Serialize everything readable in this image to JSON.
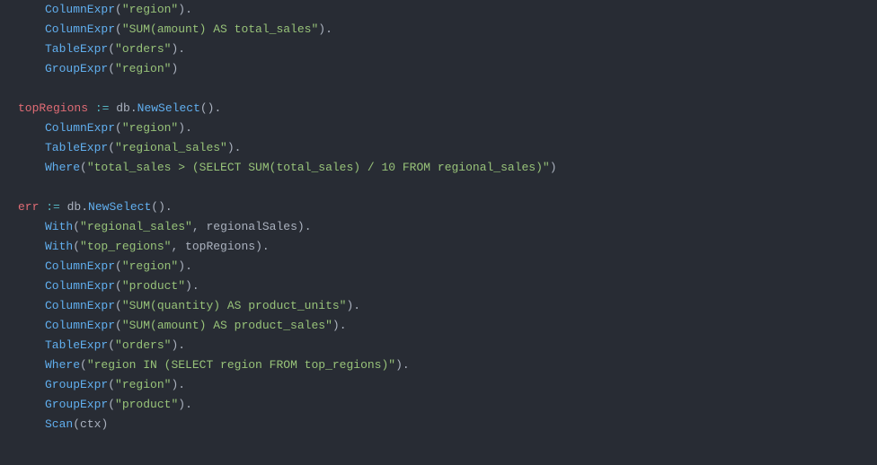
{
  "lines": [
    {
      "indent": 1,
      "tokens": [
        {
          "t": "method",
          "v": "ColumnExpr"
        },
        {
          "t": "paren",
          "v": "("
        },
        {
          "t": "string",
          "v": "\"region\""
        },
        {
          "t": "paren",
          "v": ")"
        },
        {
          "t": "dot",
          "v": "."
        }
      ]
    },
    {
      "indent": 1,
      "tokens": [
        {
          "t": "method",
          "v": "ColumnExpr"
        },
        {
          "t": "paren",
          "v": "("
        },
        {
          "t": "string",
          "v": "\"SUM(amount) AS total_sales\""
        },
        {
          "t": "paren",
          "v": ")"
        },
        {
          "t": "dot",
          "v": "."
        }
      ]
    },
    {
      "indent": 1,
      "tokens": [
        {
          "t": "method",
          "v": "TableExpr"
        },
        {
          "t": "paren",
          "v": "("
        },
        {
          "t": "string",
          "v": "\"orders\""
        },
        {
          "t": "paren",
          "v": ")"
        },
        {
          "t": "dot",
          "v": "."
        }
      ]
    },
    {
      "indent": 1,
      "tokens": [
        {
          "t": "method",
          "v": "GroupExpr"
        },
        {
          "t": "paren",
          "v": "("
        },
        {
          "t": "string",
          "v": "\"region\""
        },
        {
          "t": "paren",
          "v": ")"
        }
      ]
    },
    {
      "indent": 0,
      "tokens": []
    },
    {
      "indent": 0,
      "tokens": [
        {
          "t": "ident",
          "v": "topRegions"
        },
        {
          "t": "var",
          "v": " "
        },
        {
          "t": "op",
          "v": ":="
        },
        {
          "t": "var",
          "v": " db"
        },
        {
          "t": "dot",
          "v": "."
        },
        {
          "t": "method",
          "v": "NewSelect"
        },
        {
          "t": "paren",
          "v": "()"
        },
        {
          "t": "dot",
          "v": "."
        }
      ]
    },
    {
      "indent": 1,
      "tokens": [
        {
          "t": "method",
          "v": "ColumnExpr"
        },
        {
          "t": "paren",
          "v": "("
        },
        {
          "t": "string",
          "v": "\"region\""
        },
        {
          "t": "paren",
          "v": ")"
        },
        {
          "t": "dot",
          "v": "."
        }
      ]
    },
    {
      "indent": 1,
      "tokens": [
        {
          "t": "method",
          "v": "TableExpr"
        },
        {
          "t": "paren",
          "v": "("
        },
        {
          "t": "string",
          "v": "\"regional_sales\""
        },
        {
          "t": "paren",
          "v": ")"
        },
        {
          "t": "dot",
          "v": "."
        }
      ]
    },
    {
      "indent": 1,
      "tokens": [
        {
          "t": "method",
          "v": "Where"
        },
        {
          "t": "paren",
          "v": "("
        },
        {
          "t": "string",
          "v": "\"total_sales > (SELECT SUM(total_sales) / 10 FROM regional_sales)\""
        },
        {
          "t": "paren",
          "v": ")"
        }
      ]
    },
    {
      "indent": 0,
      "tokens": []
    },
    {
      "indent": 0,
      "tokens": [
        {
          "t": "ident",
          "v": "err"
        },
        {
          "t": "var",
          "v": " "
        },
        {
          "t": "op",
          "v": ":="
        },
        {
          "t": "var",
          "v": " db"
        },
        {
          "t": "dot",
          "v": "."
        },
        {
          "t": "method",
          "v": "NewSelect"
        },
        {
          "t": "paren",
          "v": "()"
        },
        {
          "t": "dot",
          "v": "."
        }
      ]
    },
    {
      "indent": 1,
      "tokens": [
        {
          "t": "method",
          "v": "With"
        },
        {
          "t": "paren",
          "v": "("
        },
        {
          "t": "string",
          "v": "\"regional_sales\""
        },
        {
          "t": "var",
          "v": ", regionalSales"
        },
        {
          "t": "paren",
          "v": ")"
        },
        {
          "t": "dot",
          "v": "."
        }
      ]
    },
    {
      "indent": 1,
      "tokens": [
        {
          "t": "method",
          "v": "With"
        },
        {
          "t": "paren",
          "v": "("
        },
        {
          "t": "string",
          "v": "\"top_regions\""
        },
        {
          "t": "var",
          "v": ", topRegions"
        },
        {
          "t": "paren",
          "v": ")"
        },
        {
          "t": "dot",
          "v": "."
        }
      ]
    },
    {
      "indent": 1,
      "tokens": [
        {
          "t": "method",
          "v": "ColumnExpr"
        },
        {
          "t": "paren",
          "v": "("
        },
        {
          "t": "string",
          "v": "\"region\""
        },
        {
          "t": "paren",
          "v": ")"
        },
        {
          "t": "dot",
          "v": "."
        }
      ]
    },
    {
      "indent": 1,
      "tokens": [
        {
          "t": "method",
          "v": "ColumnExpr"
        },
        {
          "t": "paren",
          "v": "("
        },
        {
          "t": "string",
          "v": "\"product\""
        },
        {
          "t": "paren",
          "v": ")"
        },
        {
          "t": "dot",
          "v": "."
        }
      ]
    },
    {
      "indent": 1,
      "tokens": [
        {
          "t": "method",
          "v": "ColumnExpr"
        },
        {
          "t": "paren",
          "v": "("
        },
        {
          "t": "string",
          "v": "\"SUM(quantity) AS product_units\""
        },
        {
          "t": "paren",
          "v": ")"
        },
        {
          "t": "dot",
          "v": "."
        }
      ]
    },
    {
      "indent": 1,
      "tokens": [
        {
          "t": "method",
          "v": "ColumnExpr"
        },
        {
          "t": "paren",
          "v": "("
        },
        {
          "t": "string",
          "v": "\"SUM(amount) AS product_sales\""
        },
        {
          "t": "paren",
          "v": ")"
        },
        {
          "t": "dot",
          "v": "."
        }
      ]
    },
    {
      "indent": 1,
      "tokens": [
        {
          "t": "method",
          "v": "TableExpr"
        },
        {
          "t": "paren",
          "v": "("
        },
        {
          "t": "string",
          "v": "\"orders\""
        },
        {
          "t": "paren",
          "v": ")"
        },
        {
          "t": "dot",
          "v": "."
        }
      ]
    },
    {
      "indent": 1,
      "tokens": [
        {
          "t": "method",
          "v": "Where"
        },
        {
          "t": "paren",
          "v": "("
        },
        {
          "t": "string",
          "v": "\"region IN (SELECT region FROM top_regions)\""
        },
        {
          "t": "paren",
          "v": ")"
        },
        {
          "t": "dot",
          "v": "."
        }
      ]
    },
    {
      "indent": 1,
      "tokens": [
        {
          "t": "method",
          "v": "GroupExpr"
        },
        {
          "t": "paren",
          "v": "("
        },
        {
          "t": "string",
          "v": "\"region\""
        },
        {
          "t": "paren",
          "v": ")"
        },
        {
          "t": "dot",
          "v": "."
        }
      ]
    },
    {
      "indent": 1,
      "tokens": [
        {
          "t": "method",
          "v": "GroupExpr"
        },
        {
          "t": "paren",
          "v": "("
        },
        {
          "t": "string",
          "v": "\"product\""
        },
        {
          "t": "paren",
          "v": ")"
        },
        {
          "t": "dot",
          "v": "."
        }
      ]
    },
    {
      "indent": 1,
      "tokens": [
        {
          "t": "method",
          "v": "Scan"
        },
        {
          "t": "paren",
          "v": "("
        },
        {
          "t": "var",
          "v": "ctx"
        },
        {
          "t": "paren",
          "v": ")"
        }
      ]
    }
  ]
}
